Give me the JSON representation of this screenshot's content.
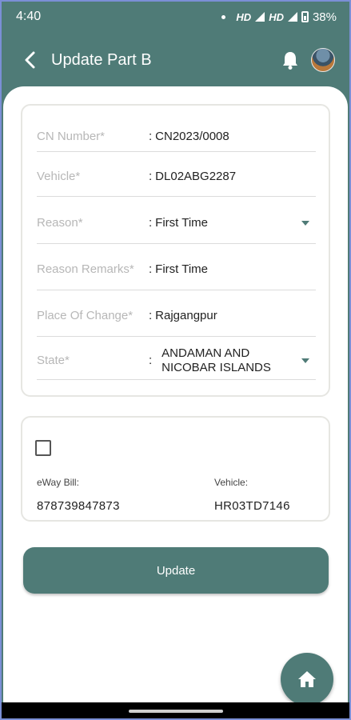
{
  "status_bar": {
    "time": "4:40",
    "network1": "HD",
    "network2": "HD",
    "battery": "38%"
  },
  "app_bar": {
    "title": "Update Part B",
    "back_icon": "arrow-back-icon",
    "notification_icon": "bell-icon",
    "avatar": "profile-avatar"
  },
  "form": {
    "separator": ":",
    "fields": [
      {
        "label": "CN Number*",
        "value": "CN2023/0008",
        "dropdown": false
      },
      {
        "label": "Vehicle*",
        "value": "DL02ABG2287",
        "dropdown": false
      },
      {
        "label": "Reason*",
        "value": "First Time",
        "dropdown": true
      },
      {
        "label": "Reason Remarks*",
        "value": "First Time",
        "dropdown": false
      },
      {
        "label": "Place Of Change*",
        "value": "Rajgangpur",
        "dropdown": false
      },
      {
        "label": "State*",
        "value_line1": "ANDAMAN AND",
        "value_line2": "NICOBAR ISLANDS",
        "dropdown": true
      }
    ]
  },
  "eway": {
    "checked": false,
    "ewb_label": "eWay Bill:",
    "ewb_value": "878739847873",
    "vehicle_label": "Vehicle:",
    "vehicle_value": "HR03TD7146"
  },
  "update_button": "Update",
  "fab_icon": "home-icon",
  "colors": {
    "primary": "#4f7b77",
    "label": "#b7b7b7"
  }
}
